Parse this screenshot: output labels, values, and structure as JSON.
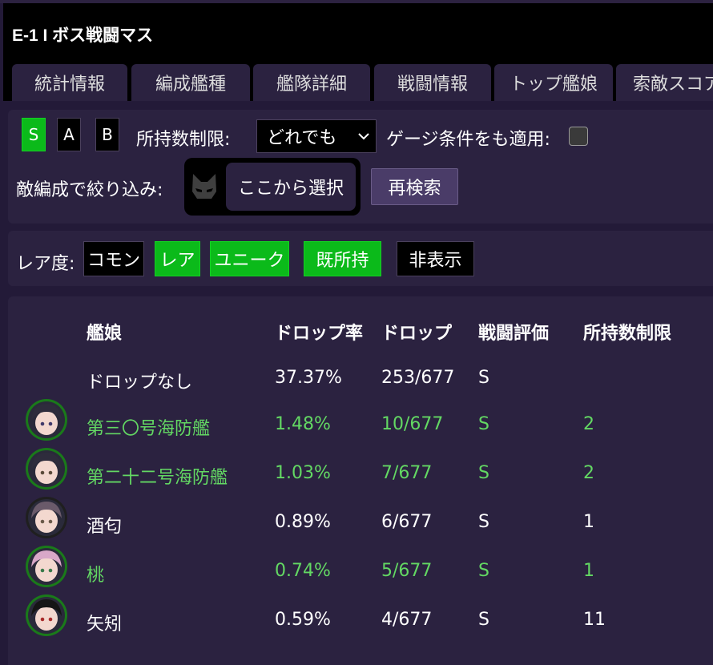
{
  "header": {
    "title": "E-1 I ボス戦闘マス"
  },
  "tabs": [
    {
      "label": "統計情報"
    },
    {
      "label": "編成艦種"
    },
    {
      "label": "艦隊詳細"
    },
    {
      "label": "戦闘情報"
    },
    {
      "label": "トップ艦娘"
    },
    {
      "label": "索敵スコア"
    }
  ],
  "filters": {
    "rank_buttons": [
      {
        "label": "S",
        "active": true
      },
      {
        "label": "A",
        "active": false
      },
      {
        "label": "B",
        "active": false
      }
    ],
    "possession_label": "所持数制限:",
    "possession_value": "どれでも",
    "gauge_label": "ゲージ条件をも適用:",
    "gauge_checked": false,
    "enemy_label": "敵編成で絞り込み:",
    "enemy_icon": "cat-face-icon",
    "choose_label": "ここから選択",
    "research_label": "再検索"
  },
  "rarity": {
    "label": "レア度:",
    "options": [
      {
        "label": "コモン",
        "active": false
      },
      {
        "label": "レア",
        "active": true
      },
      {
        "label": "ユニーク",
        "active": true
      },
      {
        "label": "既所持",
        "active": true
      },
      {
        "label": "非表示",
        "active": false
      }
    ]
  },
  "table": {
    "headers": [
      "艦娘",
      "ドロップ率",
      "ドロップ",
      "戦闘評価",
      "所持数制限"
    ],
    "rows": [
      {
        "name": "ドロップなし",
        "rate": "37.37%",
        "drop": "253/677",
        "rank": "S",
        "limit": "",
        "highlight": false,
        "avatar": false
      },
      {
        "name": "第三〇号海防艦",
        "rate": "1.48%",
        "drop": "10/677",
        "rank": "S",
        "limit": "2",
        "highlight": true,
        "avatar": true
      },
      {
        "name": "第二十二号海防艦",
        "rate": "1.03%",
        "drop": "7/677",
        "rank": "S",
        "limit": "2",
        "highlight": true,
        "avatar": true
      },
      {
        "name": "酒匂",
        "rate": "0.89%",
        "drop": "6/677",
        "rank": "S",
        "limit": "1",
        "highlight": false,
        "avatar": true
      },
      {
        "name": "桃",
        "rate": "0.74%",
        "drop": "5/677",
        "rank": "S",
        "limit": "1",
        "highlight": true,
        "avatar": true
      },
      {
        "name": "矢矧",
        "rate": "0.59%",
        "drop": "4/677",
        "rank": "S",
        "limit": "11",
        "highlight": false,
        "avatar": true
      }
    ]
  },
  "colors": {
    "background": "#231a38",
    "panel": "#2b2240",
    "active_green": "#0bba1a",
    "highlight_text": "#63d863"
  }
}
